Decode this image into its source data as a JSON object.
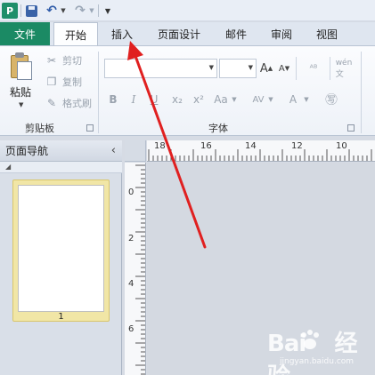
{
  "quick_access": {
    "app_logo": "P",
    "icons": [
      "save-icon",
      "undo-icon",
      "redo-icon",
      "customize-toolbar-icon"
    ]
  },
  "tabs": {
    "file": "文件",
    "home": "开始",
    "insert": "插入",
    "page_design": "页面设计",
    "mailings": "邮件",
    "review": "审阅",
    "view": "视图"
  },
  "clipboard_group": {
    "paste": "粘贴",
    "cut": "剪切",
    "copy": "复制",
    "format_painter": "格式刷",
    "label": "剪贴板"
  },
  "font_group": {
    "label": "字体",
    "font_name": "",
    "font_size": "",
    "bold": "B",
    "italic": "I",
    "underline": "U",
    "subscript": "x₂",
    "superscript": "x²",
    "change_case": "Aa",
    "char_spacing": "AV",
    "font_color": "A",
    "grow_font": "A",
    "shrink_font": "A"
  },
  "nav_pane": {
    "title": "页面导航",
    "page_number": "1"
  },
  "rulers": {
    "horizontal_labels": [
      "18",
      "16",
      "14",
      "12",
      "10"
    ],
    "vertical_labels": [
      "0",
      "2",
      "4",
      "6"
    ]
  },
  "watermark": {
    "logo_text": "Bai 经验",
    "url": "jingyan.baidu.com"
  },
  "colors": {
    "file_tab": "#1b8a64",
    "annotation_arrow": "#e02020",
    "thumbnail_highlight": "#f1e6a6"
  }
}
